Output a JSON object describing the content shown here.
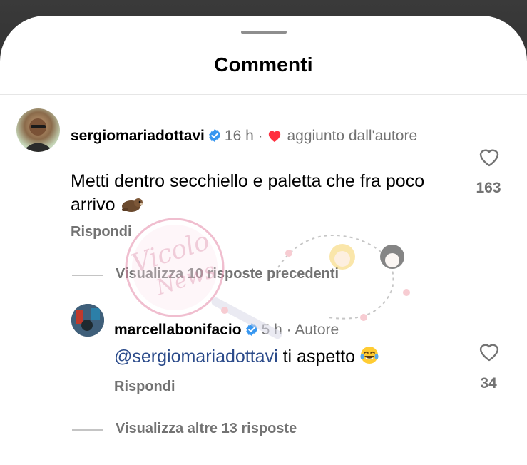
{
  "sheet": {
    "title": "Commenti"
  },
  "comments": [
    {
      "username": "sergiomariadottavi",
      "time": "16 h",
      "separator": "·",
      "author_badge": "aggiunto dall'autore",
      "text": "Metti dentro secchiello e paletta che fra poco arrivo",
      "text_emoji": "otter-emoji",
      "reply_label": "Rispondi",
      "likes": "163",
      "view_replies": "Visualizza 10 risposte precedenti"
    },
    {
      "username": "marcellabonifacio",
      "time": "5 h",
      "separator": "·",
      "author_badge": "Autore",
      "mention": "@sergiomariadottavi",
      "text": "ti aspetto",
      "text_emoji": "tears-of-joy-emoji",
      "reply_label": "Rispondi",
      "likes": "34",
      "view_replies": "Visualizza altre 13 risposte"
    }
  ],
  "watermark": {
    "line1": "Vicolo",
    "line2": "News"
  },
  "colors": {
    "verified": "#3897f0",
    "heart_red": "#ff3040",
    "meta_gray": "#737373",
    "mention_blue": "#2a4a8a"
  },
  "icons": {
    "verified": "verified-badge-icon",
    "creator_heart": "heart-filled-icon",
    "like": "heart-outline-icon"
  }
}
